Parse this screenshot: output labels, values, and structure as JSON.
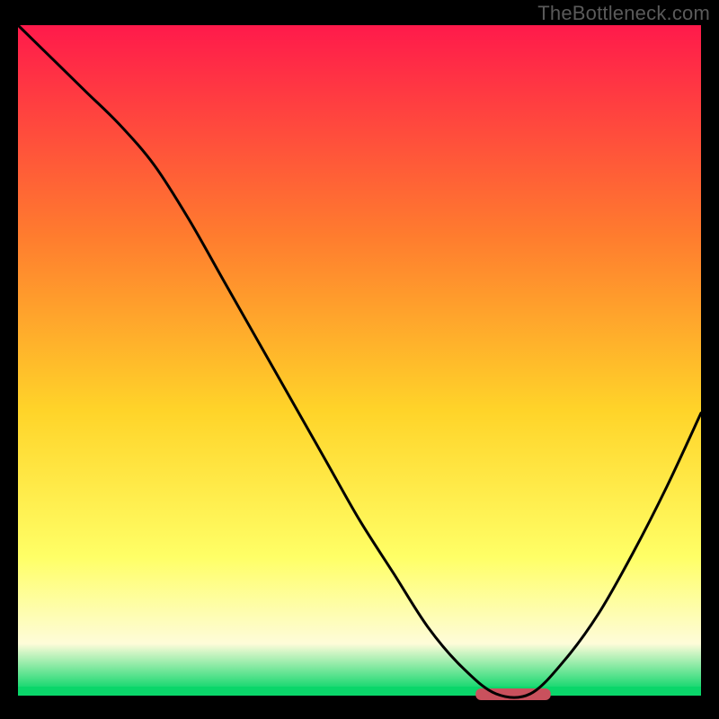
{
  "watermark": "TheBottleneck.com",
  "colors": {
    "gradient_top": "#ff1a4b",
    "gradient_mid1": "#ff7d2e",
    "gradient_mid2": "#ffd429",
    "gradient_mid3": "#ffff66",
    "gradient_mid4": "#fefcd9",
    "gradient_bottom": "#0ad66a",
    "marker": "#c9515d",
    "curve": "#000000",
    "frame": "#000000"
  },
  "chart_data": {
    "type": "line",
    "title": "",
    "xlabel": "",
    "ylabel": "",
    "xlim": [
      0,
      100
    ],
    "ylim": [
      0,
      100
    ],
    "x": [
      0,
      5,
      10,
      15,
      20,
      25,
      30,
      35,
      40,
      45,
      50,
      55,
      60,
      65,
      70,
      75,
      80,
      85,
      90,
      95,
      100
    ],
    "values": [
      100,
      95,
      90,
      85,
      79,
      71,
      62,
      53,
      44,
      35,
      26,
      18,
      10,
      4,
      0,
      0,
      5,
      12,
      21,
      31,
      42
    ],
    "optimal_range_x": [
      67,
      78
    ],
    "annotations": []
  }
}
